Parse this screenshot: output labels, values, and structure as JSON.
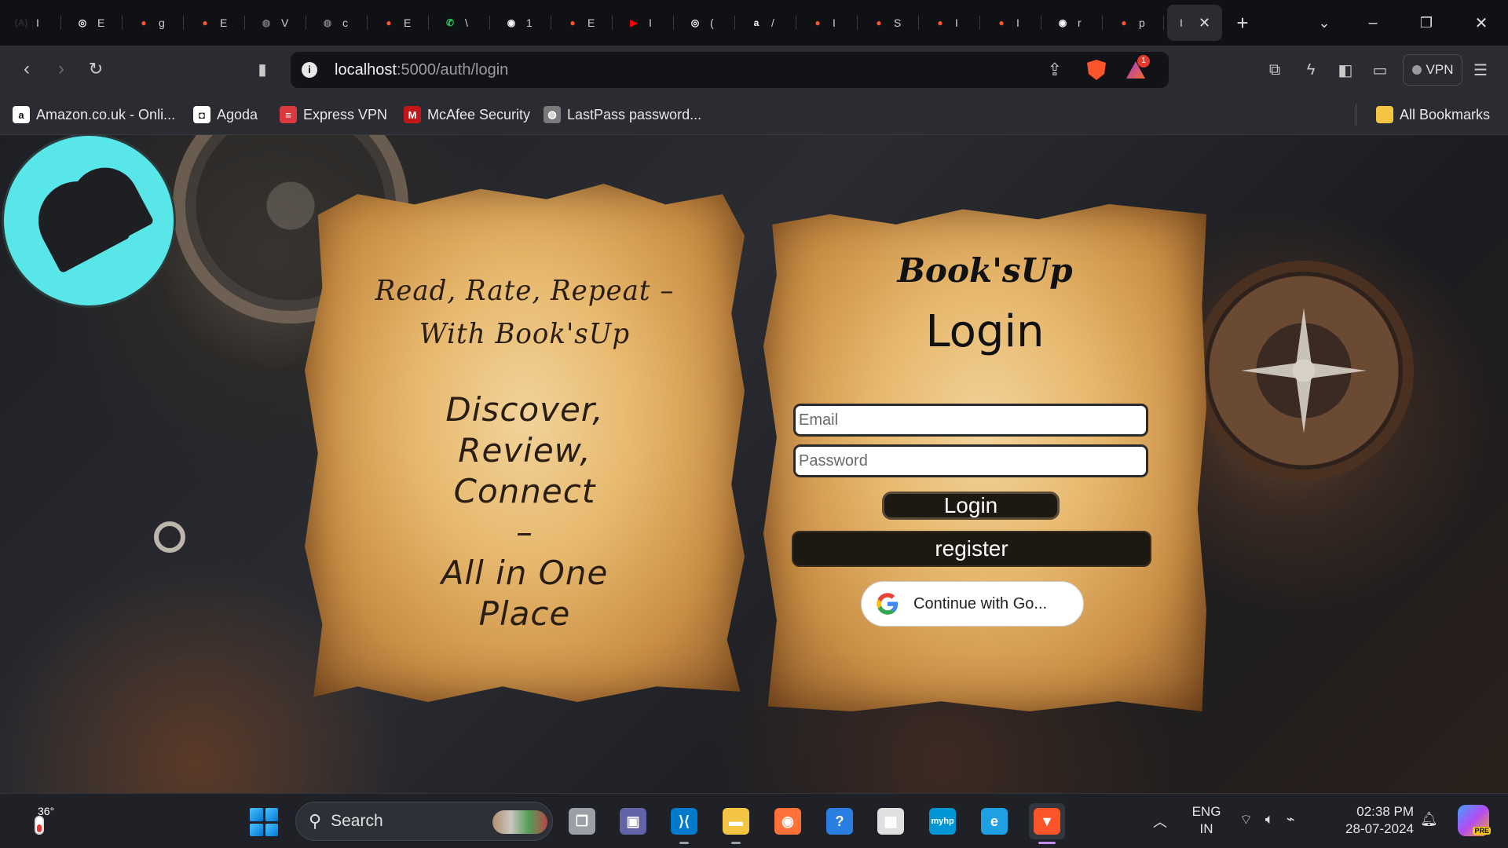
{
  "browser": {
    "tabs": [
      {
        "icon": "a-logo-icon",
        "glyph": "(A)",
        "title": "I",
        "color": "#2b2c31"
      },
      {
        "icon": "chatgpt-icon",
        "glyph": "◎",
        "title": "E",
        "color": "#ffffff"
      },
      {
        "icon": "brave-icon",
        "glyph": "●",
        "title": "g",
        "color": "#fb542b"
      },
      {
        "icon": "brave-icon",
        "glyph": "●",
        "title": "E",
        "color": "#fb542b"
      },
      {
        "icon": "globe-icon",
        "glyph": "◍",
        "title": "V",
        "color": "#7a7a7a"
      },
      {
        "icon": "globe-icon",
        "glyph": "◍",
        "title": "c",
        "color": "#7a7a7a"
      },
      {
        "icon": "brave-icon",
        "glyph": "●",
        "title": "E",
        "color": "#fb542b"
      },
      {
        "icon": "whatsapp-icon",
        "glyph": "✆",
        "title": "\\",
        "color": "#25d366"
      },
      {
        "icon": "github-icon",
        "glyph": "◉",
        "title": "1",
        "color": "#ffffff"
      },
      {
        "icon": "brave-icon",
        "glyph": "●",
        "title": "E",
        "color": "#fb542b"
      },
      {
        "icon": "youtube-icon",
        "glyph": "▶",
        "title": "I",
        "color": "#ff0000"
      },
      {
        "icon": "chatgpt-icon",
        "glyph": "◎",
        "title": "(",
        "color": "#ffffff"
      },
      {
        "icon": "amazon-icon",
        "glyph": "a",
        "title": "/",
        "color": "#ffffff"
      },
      {
        "icon": "brave-icon",
        "glyph": "●",
        "title": "I",
        "color": "#fb542b"
      },
      {
        "icon": "brave-icon",
        "glyph": "●",
        "title": "S",
        "color": "#fb542b"
      },
      {
        "icon": "brave-icon",
        "glyph": "●",
        "title": "I",
        "color": "#fb542b"
      },
      {
        "icon": "brave-icon",
        "glyph": "●",
        "title": "I",
        "color": "#fb542b"
      },
      {
        "icon": "github-icon",
        "glyph": "◉",
        "title": "r",
        "color": "#ffffff"
      },
      {
        "icon": "brave-icon",
        "glyph": "●",
        "title": "p",
        "color": "#fb542b"
      }
    ],
    "active_tab_title": "I",
    "url_host": "localhost",
    "url_rest": ":5000/auth/login",
    "rewards_count": "1",
    "vpn_label": "VPN",
    "bookmarks": [
      {
        "label": "Amazon.co.uk - Onli...",
        "icon": "amazon-icon",
        "glyph": "a",
        "bg": "#ffffff",
        "fg": "#111111"
      },
      {
        "label": "Agoda",
        "icon": "agoda-icon",
        "glyph": "◘",
        "bg": "#ffffff",
        "fg": "#111111"
      },
      {
        "label": "Express VPN",
        "icon": "expressvpn-icon",
        "glyph": "≡",
        "bg": "#da3940",
        "fg": "#ffffff"
      },
      {
        "label": "McAfee Security",
        "icon": "mcafee-icon",
        "glyph": "M",
        "bg": "#c01818",
        "fg": "#ffffff"
      },
      {
        "label": "LastPass password...",
        "icon": "globe-icon",
        "glyph": "◍",
        "bg": "#7a7a7a",
        "fg": "#ffffff"
      }
    ],
    "all_bookmarks_label": "All Bookmarks"
  },
  "page": {
    "tagline": "Read, Rate, Repeat – With Book'sUp",
    "pitch_lines": [
      "Discover,",
      "Review,",
      "Connect",
      "–",
      "All in One",
      "Place"
    ],
    "brand": "Book'sUp",
    "login_title": "Login",
    "email_placeholder": "Email",
    "password_placeholder": "Password",
    "login_button": "Login",
    "register_button": "register",
    "google_button": "Continue with Go..."
  },
  "taskbar": {
    "temperature": "36°",
    "search_label": "Search",
    "apps": [
      {
        "name": "task-view",
        "glyph": "❐",
        "color": "#9aa0a6"
      },
      {
        "name": "teams",
        "glyph": "▣",
        "color": "#6264a7"
      },
      {
        "name": "vscode",
        "glyph": "⟩⟨",
        "color": "#007acc"
      },
      {
        "name": "file-explorer",
        "glyph": "▬",
        "color": "#f4c542"
      },
      {
        "name": "firefox",
        "glyph": "◉",
        "color": "#ff7139"
      },
      {
        "name": "get-help",
        "glyph": "?",
        "color": "#2a7de1"
      },
      {
        "name": "microsoft-store",
        "glyph": "▦",
        "color": "#e0e0e0"
      },
      {
        "name": "myhp",
        "glyph": "myhp",
        "color": "#0096d6"
      },
      {
        "name": "edge",
        "glyph": "e",
        "color": "#1fa0e2"
      },
      {
        "name": "brave",
        "glyph": "▼",
        "color": "#fb542b"
      }
    ],
    "lang_top": "ENG",
    "lang_bottom": "IN",
    "time": "02:38 PM",
    "date": "28-07-2024",
    "copilot_badge": "PRE"
  }
}
